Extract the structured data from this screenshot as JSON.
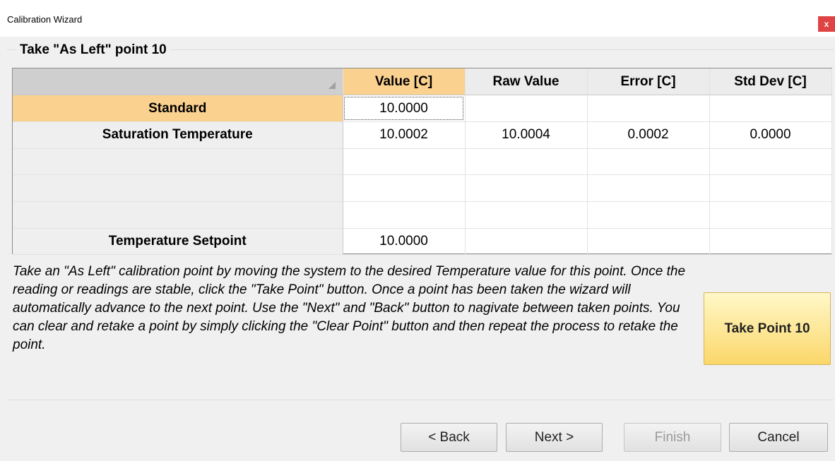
{
  "window": {
    "title": "Calibration Wizard",
    "close_label": "x"
  },
  "group": {
    "title": "Take \"As Left\" point 10"
  },
  "grid": {
    "columns": [
      "Value [C]",
      "Raw Value",
      "Error [C]",
      "Std Dev [C]"
    ],
    "rows": [
      {
        "label": "Standard",
        "cells": [
          "10.0000",
          "",
          "",
          ""
        ]
      },
      {
        "label": "Saturation Temperature",
        "cells": [
          "10.0002",
          "10.0004",
          "0.0002",
          "0.0000"
        ]
      },
      {
        "label": "",
        "cells": [
          "",
          "",
          "",
          ""
        ]
      },
      {
        "label": "",
        "cells": [
          "",
          "",
          "",
          ""
        ]
      },
      {
        "label": "",
        "cells": [
          "",
          "",
          "",
          ""
        ]
      },
      {
        "label": "Temperature Setpoint",
        "cells": [
          "10.0000",
          "",
          "",
          ""
        ]
      }
    ]
  },
  "instructions": "Take an \"As Left\" calibration point by moving the system to the desired Temperature value for this point.  Once the reading or readings are stable, click the \"Take Point\" button.  Once a point has been taken the wizard will automatically advance to the next point.  Use the \"Next\" and \"Back\" button to nagivate between taken points.  You can clear and retake a point by simply clicking the \"Clear Point\" button and then repeat the process to retake the point.",
  "take_point_label": "Take Point 10",
  "nav": {
    "back": "< Back",
    "next": "Next >",
    "finish": "Finish",
    "cancel": "Cancel"
  }
}
